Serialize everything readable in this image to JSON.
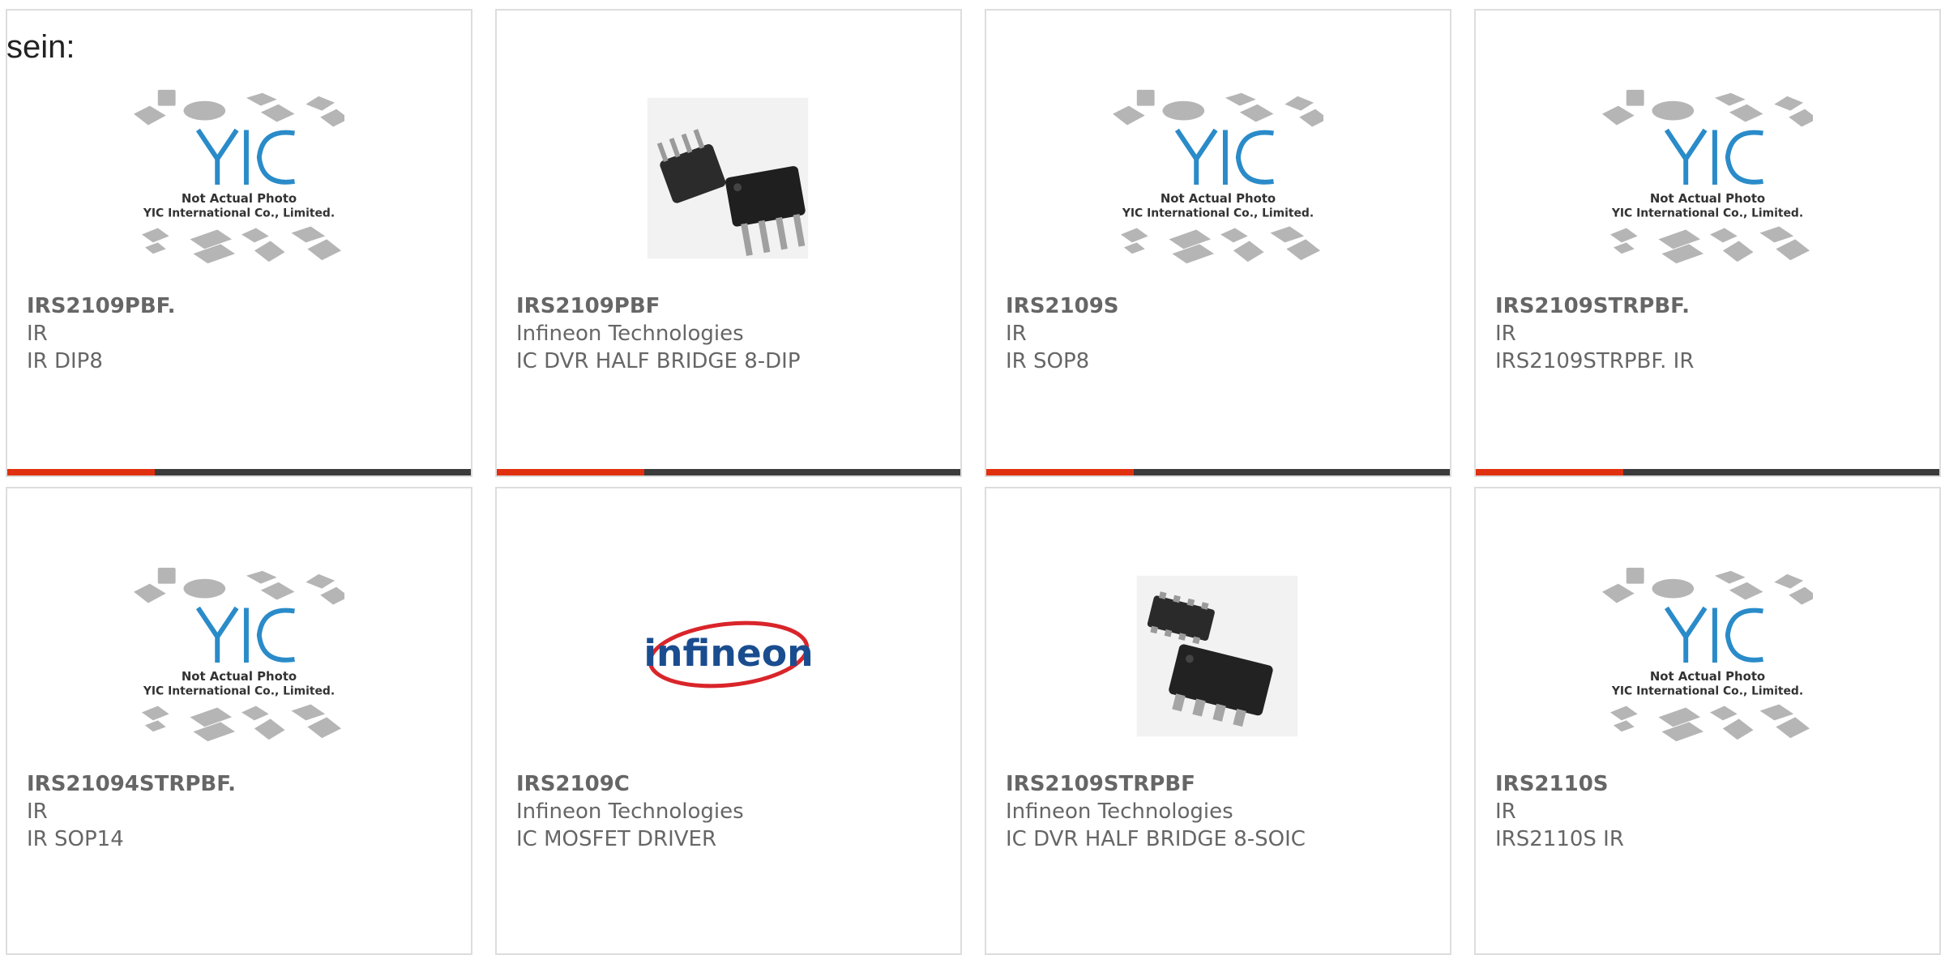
{
  "intro_text": "sein:",
  "colors": {
    "accent": "#e0300f",
    "bar": "#3b3b3b",
    "yic_blue": "#2a8bc9",
    "infineon_blue": "#1a4d8f",
    "infineon_red": "#d9252a"
  },
  "placeholder": {
    "line1": "Not Actual Photo",
    "line2": "YIC International Co., Limited.",
    "logo": "YIC"
  },
  "products": [
    {
      "part": "IRS2109PBF.",
      "manufacturer": "IR",
      "description": "IR DIP8",
      "image": "yic-placeholder"
    },
    {
      "part": "IRS2109PBF",
      "manufacturer": "Infineon Technologies",
      "description": "IC DVR HALF BRIDGE 8-DIP",
      "image": "dip8-chip-photo"
    },
    {
      "part": "IRS2109S",
      "manufacturer": "IR",
      "description": "IR SOP8",
      "image": "yic-placeholder"
    },
    {
      "part": "IRS2109STRPBF.",
      "manufacturer": "IR",
      "description": "IRS2109STRPBF. IR",
      "image": "yic-placeholder"
    },
    {
      "part": "IRS21094STRPBF.",
      "manufacturer": "IR",
      "description": "IR SOP14",
      "image": "yic-placeholder"
    },
    {
      "part": "IRS2109C",
      "manufacturer": "Infineon Technologies",
      "description": "IC MOSFET DRIVER",
      "image": "infineon-logo",
      "logo_text": "infineon"
    },
    {
      "part": "IRS2109STRPBF",
      "manufacturer": "Infineon Technologies",
      "description": "IC DVR HALF BRIDGE 8-SOIC",
      "image": "soic8-chip-photo"
    },
    {
      "part": "IRS2110S",
      "manufacturer": "IR",
      "description": "IRS2110S IR",
      "image": "yic-placeholder"
    }
  ]
}
